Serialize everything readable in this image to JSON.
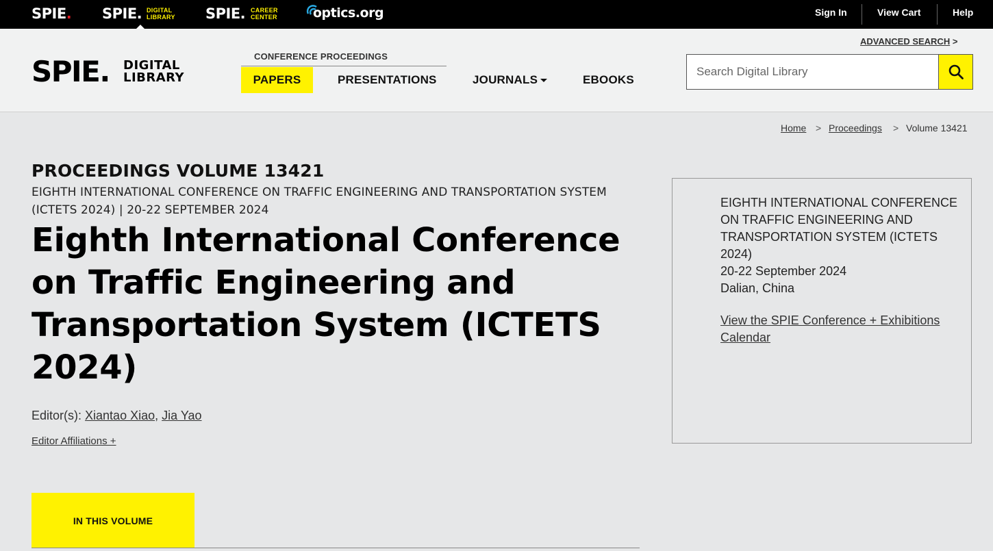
{
  "topbar": {
    "spie": "SPIE",
    "spie_dot": ".",
    "dl_logo": "SPIE.",
    "dl_sub1": "DIGITAL",
    "dl_sub2": "LIBRARY",
    "cc_logo": "SPIE.",
    "cc_sub1": "CAREER",
    "cc_sub2": "CENTER",
    "optics": "optics.org",
    "sign_in": "Sign In",
    "view_cart": "View Cart",
    "help": "Help"
  },
  "header": {
    "logo_spie": "SPIE.",
    "logo_dl_1": "DIGITAL",
    "logo_dl_2": "LIBRARY",
    "conf_proceedings": "CONFERENCE PROCEEDINGS",
    "nav": {
      "papers": "PAPERS",
      "presentations": "PRESENTATIONS",
      "journals": "JOURNALS",
      "ebooks": "EBOOKS"
    },
    "advanced_search": "ADVANCED SEARCH",
    "advanced_search_arrow": ">",
    "search_placeholder": "Search Digital Library"
  },
  "breadcrumb": {
    "home": "Home",
    "proceedings": "Proceedings",
    "current": "Volume 13421",
    "sep": ">"
  },
  "main": {
    "volume_label": "PROCEEDINGS VOLUME 13421",
    "conference_subtitle": "EIGHTH INTERNATIONAL CONFERENCE ON TRAFFIC ENGINEERING AND TRANSPORTATION SYSTEM (ICTETS 2024) | 20-22 SEPTEMBER 2024",
    "title": "Eighth International Conference on Traffic Engineering and Transportation System (ICTETS 2024)",
    "editors_label": "Editor(s):",
    "editor1": "Xiantao Xiao",
    "editor_sep": ",",
    "editor2": "Jia Yao",
    "affiliations": "Editor Affiliations +",
    "in_this_volume": "IN THIS VOLUME"
  },
  "sidebox": {
    "conference": "EIGHTH INTERNATIONAL CONFERENCE ON TRAFFIC ENGINEERING AND TRANSPORTATION SYSTEM (ICTETS 2024)",
    "dates": "20-22 September 2024",
    "location": "Dalian, China",
    "calendar_link": "View the SPIE Conference + Exhibitions Calendar"
  },
  "colors": {
    "accent_yellow": "#fff200",
    "topbar_bg": "#000000",
    "spie_red": "#e31b23"
  }
}
